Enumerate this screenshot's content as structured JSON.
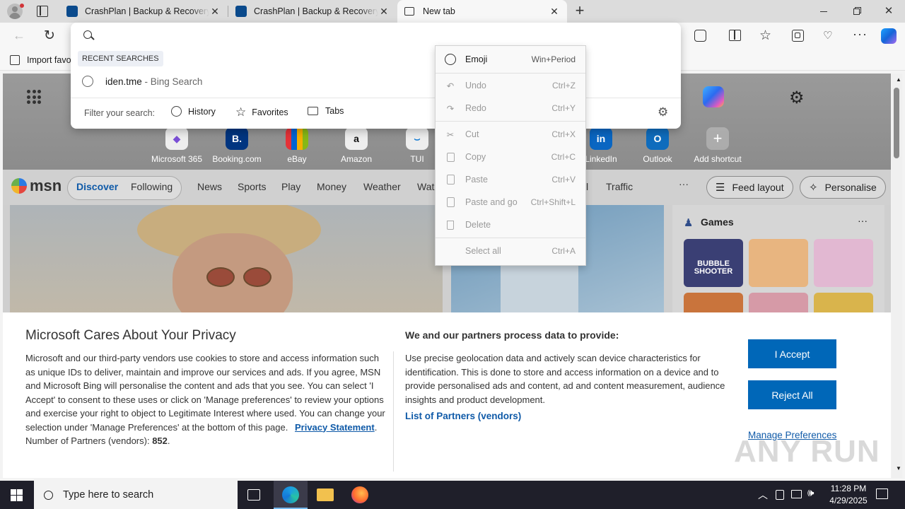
{
  "tabs": [
    {
      "title": "CrashPlan | Backup & Recovery Software"
    },
    {
      "title": "CrashPlan | Backup & Recovery Software"
    },
    {
      "title": "New tab"
    }
  ],
  "favorites_bar": {
    "import_label": "Import favo"
  },
  "omnibox": {
    "value": "",
    "recent_header": "RECENT SEARCHES",
    "recent_items": [
      {
        "query": "iden.tme",
        "suffix": " - Bing Search"
      }
    ],
    "filter_label": "Filter your search:",
    "filters": [
      "History",
      "Favorites",
      "Tabs"
    ]
  },
  "context_menu": [
    {
      "label": "Emoji",
      "shortcut": "Win+Period"
    },
    {
      "label": "Undo",
      "shortcut": "Ctrl+Z"
    },
    {
      "label": "Redo",
      "shortcut": "Ctrl+Y"
    },
    {
      "label": "Cut",
      "shortcut": "Ctrl+X"
    },
    {
      "label": "Copy",
      "shortcut": "Ctrl+C"
    },
    {
      "label": "Paste",
      "shortcut": "Ctrl+V"
    },
    {
      "label": "Paste and go",
      "shortcut": "Ctrl+Shift+L"
    },
    {
      "label": "Delete",
      "shortcut": ""
    },
    {
      "label": "Select all",
      "shortcut": "Ctrl+A"
    }
  ],
  "shortcuts": [
    "Microsoft 365",
    "Booking.com",
    "eBay",
    "Amazon",
    "TUI",
    "LinkedIn",
    "Outlook",
    "Add shortcut"
  ],
  "msn": {
    "logo": "msn",
    "tabs": [
      "Discover",
      "Following"
    ],
    "nav": [
      "News",
      "Sports",
      "Play",
      "Money",
      "Weather",
      "Wat",
      "l",
      "Traffic"
    ],
    "feed_layout": "Feed layout",
    "personalise": "Personalise",
    "games_title": "Games",
    "game_tile_text": "BUBBLE SHOOTER"
  },
  "privacy": {
    "title": "Microsoft Cares About Your Privacy",
    "body": "Microsoft and our third-party vendors use cookies to store and access information such as unique IDs to deliver, maintain and improve our services and ads. If you agree, MSN and Microsoft Bing will personalise the content and ads that you see. You can select 'I Accept' to consent to these uses or click on 'Manage preferences' to review your options and exercise your right to object to Legitimate Interest where used.  You can change your selection under 'Manage Preferences' at the bottom of this page.",
    "privacy_link": "Privacy Statement",
    "partners_label": "Number of Partners (vendors):",
    "partners_count": "852",
    "right_title": "We and our partners process data to provide:",
    "right_body": "Use precise geolocation data and actively scan device characteristics for identification. This is done to store and access information on a device and to provide personalised ads and content, ad and content measurement, audience insights and product development.",
    "partners_link": "List of Partners (vendors)",
    "accept": "I Accept",
    "reject": "Reject All",
    "manage": "Manage Preferences"
  },
  "taskbar": {
    "search_placeholder": "Type here to search",
    "time": "11:28 PM",
    "date": "4/29/2025"
  },
  "watermark": "ANY RUN"
}
